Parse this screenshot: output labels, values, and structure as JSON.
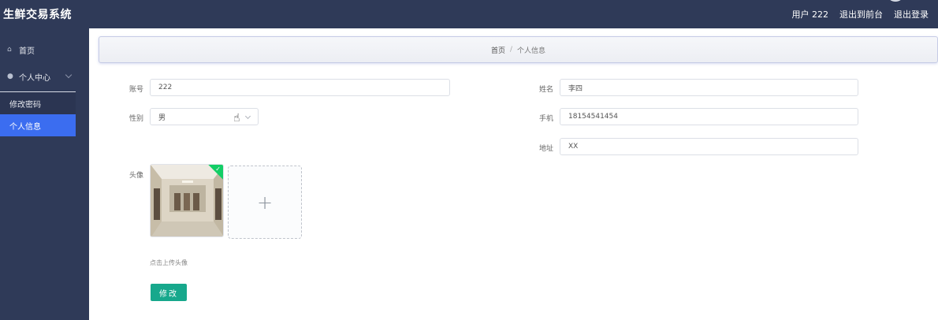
{
  "header": {
    "app_title": "生鲜交易系统",
    "user_label": "用户 222",
    "back_to_front": "退出到前台",
    "logout": "退出登录"
  },
  "sidebar": {
    "items": [
      {
        "label": "首页",
        "icon": "home-icon"
      },
      {
        "label": "个人中心",
        "icon": "user-icon"
      }
    ],
    "submenu": [
      {
        "label": "修改密码",
        "active": false
      },
      {
        "label": "个人信息",
        "active": true
      }
    ]
  },
  "breadcrumb": {
    "home": "首页",
    "separator": "/",
    "current": "个人信息"
  },
  "form": {
    "account_label": "账号",
    "account_value": "222",
    "gender_label": "性别",
    "gender_value": "男",
    "name_label": "姓名",
    "name_value": "李四",
    "phone_label": "手机",
    "phone_value": "18154541454",
    "address_label": "地址",
    "address_value": "XX",
    "avatar_label": "头像",
    "upload_hint": "点击上传头像",
    "submit_label": "修改"
  },
  "colors": {
    "sidebar_bg": "#2f3a58",
    "active_menu": "#3b6df0",
    "submit_button": "#17a88c",
    "upload_success": "#13ce66"
  }
}
